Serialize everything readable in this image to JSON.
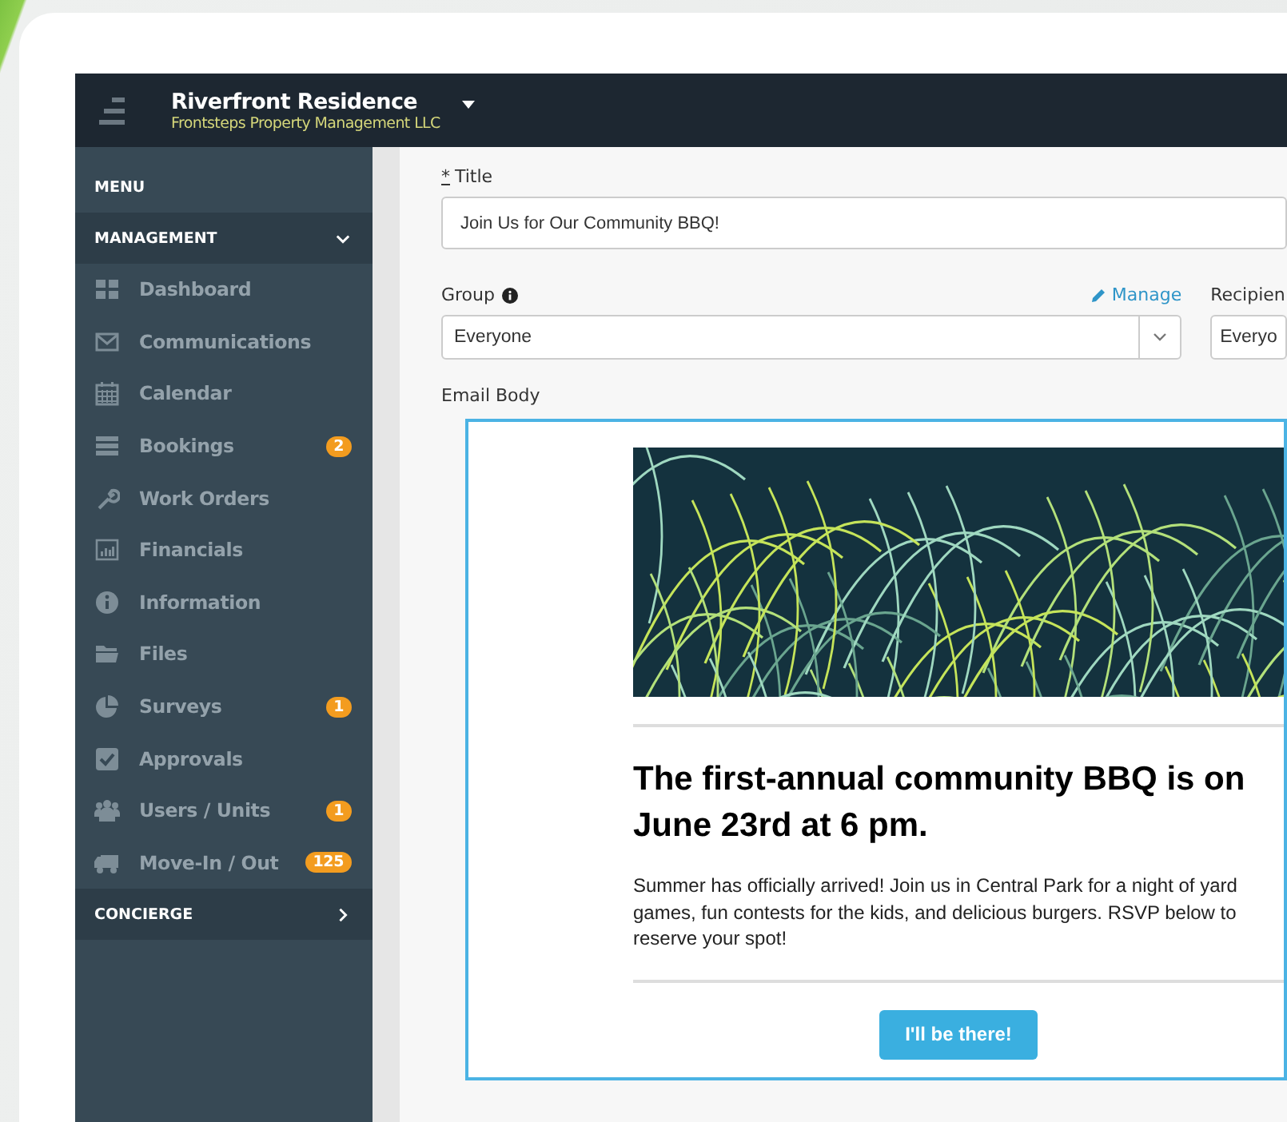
{
  "header": {
    "title": "Riverfront Residence",
    "subtitle": "Frontsteps Property Management LLC"
  },
  "sidebar": {
    "menu_label": "MENU",
    "sections": [
      {
        "label": "MANAGEMENT",
        "expanded": true,
        "items": [
          {
            "label": "Dashboard"
          },
          {
            "label": "Communications"
          },
          {
            "label": "Calendar"
          },
          {
            "label": "Bookings",
            "badge": "2"
          },
          {
            "label": "Work Orders"
          },
          {
            "label": "Financials"
          },
          {
            "label": "Information"
          },
          {
            "label": "Files"
          },
          {
            "label": "Surveys",
            "badge": "1"
          },
          {
            "label": "Approvals"
          },
          {
            "label": "Users / Units",
            "badge": "1"
          },
          {
            "label": "Move-In / Out",
            "badge": "125"
          }
        ]
      },
      {
        "label": "CONCIERGE",
        "expanded": false
      }
    ]
  },
  "form": {
    "title_field": {
      "required_mark": "*",
      "label": "Title",
      "value": "Join Us for Our Community BBQ!"
    },
    "group_field": {
      "label": "Group",
      "value": "Everyone"
    },
    "manage_link": "Manage",
    "recipient_field": {
      "label": "Recipien",
      "value": "Everyo"
    },
    "email_body_label": "Email Body"
  },
  "email": {
    "heading": "The first-annual community BBQ is on June 23rd at 6 pm.",
    "body": "Summer has officially arrived! Join us in Central Park for a night of yard games, fun contests for the kids, and delicious burgers. RSVP below to reserve your spot!",
    "button": "I'll be there!"
  }
}
